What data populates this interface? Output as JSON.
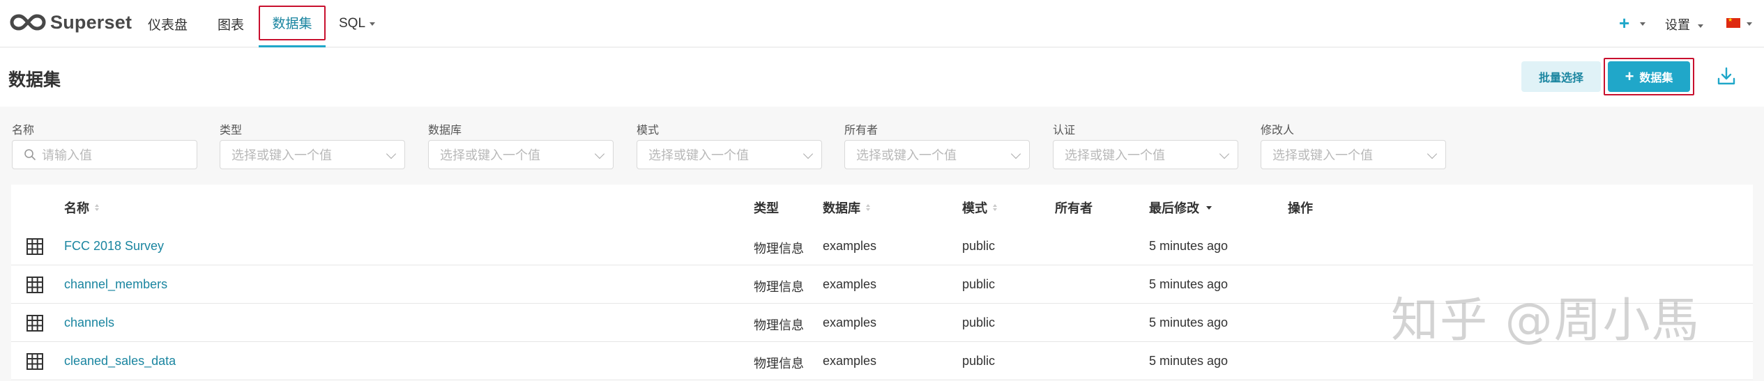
{
  "navbar": {
    "brand": "Superset",
    "items": [
      {
        "label": "仪表盘"
      },
      {
        "label": "图表"
      },
      {
        "label": "数据集"
      },
      {
        "label": "SQL"
      }
    ],
    "add_icon": "plus-icon",
    "settings_label": "设置",
    "language_icon": "flag-cn-icon"
  },
  "header": {
    "title": "数据集",
    "bulk_select_label": "批量选择",
    "add_dataset_label": "数据集",
    "download_icon": "download-icon"
  },
  "filters": [
    {
      "label": "名称",
      "placeholder": "请输入值"
    },
    {
      "label": "类型",
      "placeholder": "选择或键入一个值"
    },
    {
      "label": "数据库",
      "placeholder": "选择或键入一个值"
    },
    {
      "label": "模式",
      "placeholder": "选择或键入一个值"
    },
    {
      "label": "所有者",
      "placeholder": "选择或键入一个值"
    },
    {
      "label": "认证",
      "placeholder": "选择或键入一个值"
    },
    {
      "label": "修改人",
      "placeholder": "选择或键入一个值"
    }
  ],
  "table": {
    "columns": [
      "名称",
      "类型",
      "数据库",
      "模式",
      "所有者",
      "最后修改",
      "操作"
    ],
    "rows": [
      {
        "name": "FCC 2018 Survey",
        "type": "物理信息",
        "database": "examples",
        "schema": "public",
        "owner": "",
        "modified": "5 minutes ago"
      },
      {
        "name": "channel_members",
        "type": "物理信息",
        "database": "examples",
        "schema": "public",
        "owner": "",
        "modified": "5 minutes ago"
      },
      {
        "name": "channels",
        "type": "物理信息",
        "database": "examples",
        "schema": "public",
        "owner": "",
        "modified": "5 minutes ago"
      },
      {
        "name": "cleaned_sales_data",
        "type": "物理信息",
        "database": "examples",
        "schema": "public",
        "owner": "",
        "modified": "5 minutes ago"
      }
    ]
  },
  "watermark": "知乎 @周小馬",
  "colors": {
    "accent": "#20a7c9",
    "highlight_outline": "#c8102e",
    "link": "#1a85a0"
  }
}
